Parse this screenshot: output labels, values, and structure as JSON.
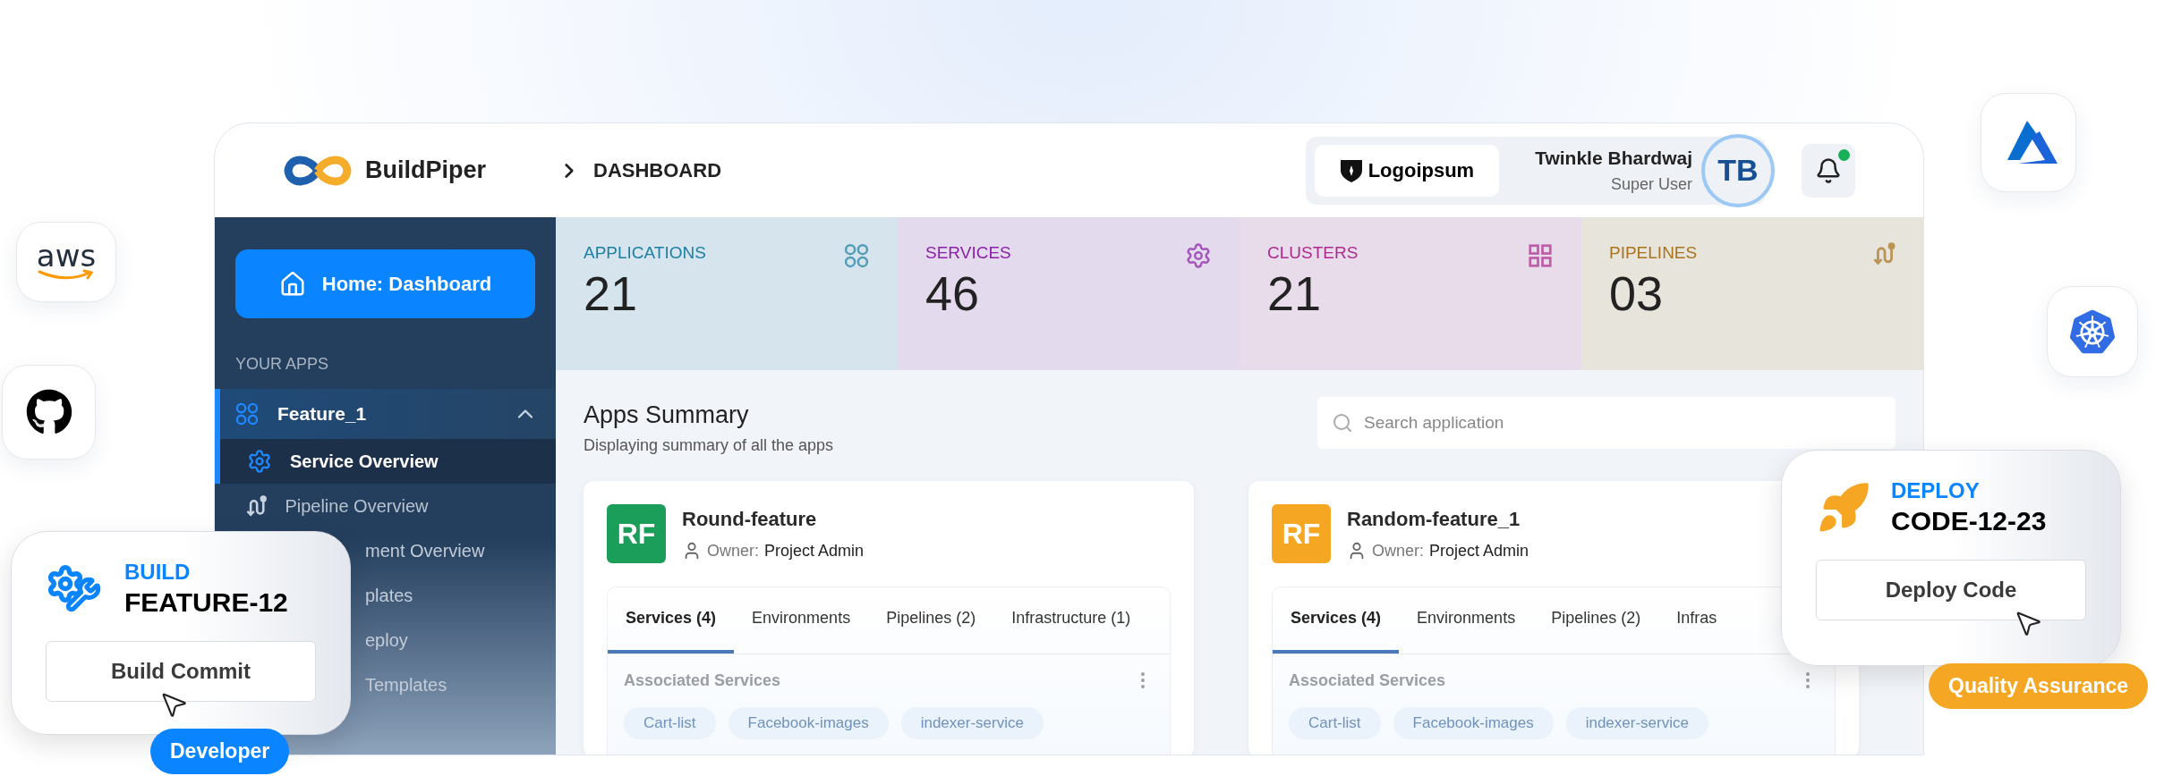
{
  "floating_logos": [
    {
      "kind": "aws",
      "text": "aws"
    },
    {
      "kind": "github"
    },
    {
      "kind": "azure"
    },
    {
      "kind": "kubernetes"
    }
  ],
  "header": {
    "brand": "BuildPiper",
    "breadcrumb": "DASHBOARD",
    "org_logo": "Logoipsum",
    "user": {
      "name": "Twinkle Bhardwaj",
      "role": "Super User",
      "initials": "TB"
    },
    "notifications": {
      "unread": true
    }
  },
  "sidebar": {
    "home_button": "Home: Dashboard",
    "section_title": "YOUR APPS",
    "app": {
      "name": "Feature_1",
      "expanded": true,
      "items": [
        {
          "label": "Service Overview",
          "kind": "service",
          "selected": true
        },
        {
          "label": "Pipeline Overview",
          "kind": "pipeline",
          "selected": false
        },
        {
          "label": "ment Overview",
          "kind": "partial",
          "selected": false
        },
        {
          "label": "plates",
          "kind": "partial",
          "selected": false
        },
        {
          "label": "eploy",
          "kind": "partial",
          "selected": false
        },
        {
          "label": "Templates",
          "kind": "partial",
          "selected": false
        }
      ]
    }
  },
  "stats": [
    {
      "label": "APPLICATIONS",
      "value": "21",
      "kind": "apps",
      "color": "#1b7ea3"
    },
    {
      "label": "SERVICES",
      "value": "46",
      "kind": "gear",
      "color": "#8a1fa8"
    },
    {
      "label": "CLUSTERS",
      "value": "21",
      "kind": "grid",
      "color": "#ad2a8e"
    },
    {
      "label": "PIPELINES",
      "value": "03",
      "kind": "pipeline",
      "color": "#a8731c"
    }
  ],
  "summary": {
    "title": "Apps Summary",
    "subtitle": "Displaying summary of all the apps",
    "search": {
      "placeholder": "Search application"
    }
  },
  "apps": [
    {
      "initials": "RF",
      "color": "#1a9e5a",
      "name": "Round-feature",
      "owner_label": "Owner:",
      "owner": "Project Admin",
      "tabs": [
        {
          "label": "Services (4)",
          "selected": true
        },
        {
          "label": "Environments",
          "selected": false
        },
        {
          "label": "Pipelines (2)",
          "selected": false
        },
        {
          "label": "Infrastructure (1)",
          "selected": false
        }
      ],
      "section": "Associated Services",
      "services": [
        "Cart-list",
        "Facebook-images",
        "indexer-service"
      ]
    },
    {
      "initials": "RF",
      "color": "#f5a623",
      "name": "Random-feature_1",
      "owner_label": "Owner:",
      "owner": "Project Admin",
      "tabs": [
        {
          "label": "Services (4)",
          "selected": true
        },
        {
          "label": "Environments",
          "selected": false
        },
        {
          "label": "Pipelines (2)",
          "selected": false
        },
        {
          "label": "Infras",
          "selected": false
        }
      ],
      "section": "Associated Services",
      "services": [
        "Cart-list",
        "Facebook-images",
        "indexer-service"
      ]
    }
  ],
  "action_cards": [
    {
      "kind": "build",
      "label": "BUILD",
      "title": "FEATURE-12",
      "button": "Build Commit",
      "role": "Developer",
      "color": "#0a84ff"
    },
    {
      "kind": "deploy",
      "label": "DEPLOY",
      "title": "CODE-12-23",
      "button": "Deploy Code",
      "role": "Quality Assurance",
      "color": "#f5a623"
    }
  ]
}
